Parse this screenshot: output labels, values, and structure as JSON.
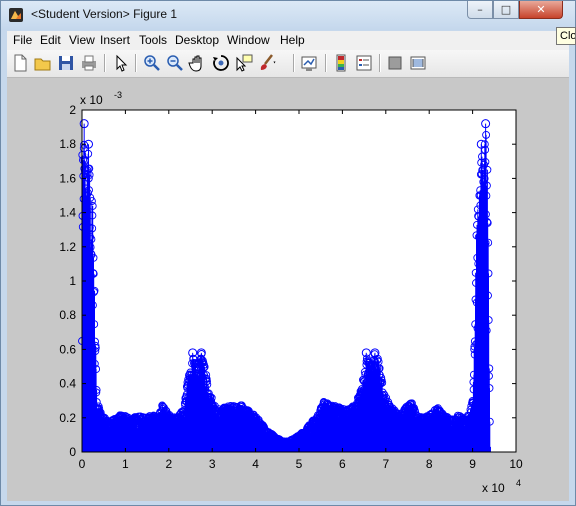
{
  "window": {
    "title": "<Student Version> Figure 1",
    "minimize_glyph": "–",
    "maximize_glyph": "□",
    "close_glyph": "✕",
    "tooltip": "Close"
  },
  "menu": [
    "File",
    "Edit",
    "View",
    "Insert",
    "Tools",
    "Desktop",
    "Window",
    "Help"
  ],
  "toolbar": {
    "icons": [
      "new-figure-icon",
      "open-file-icon",
      "save-icon",
      "print-icon",
      "edit-plot-arrow-icon",
      "zoom-in-icon",
      "zoom-out-icon",
      "pan-hand-icon",
      "rotate-3d-icon",
      "data-cursor-icon",
      "brush-icon",
      "link-plot-icon",
      "colorbar-icon",
      "legend-icon",
      "hide-plot-tools-icon",
      "show-plot-tools-icon"
    ]
  },
  "colors": {
    "series": "#0000ff",
    "axes_bg": "#ffffff",
    "figure_bg": "#c8c8c8"
  },
  "chart_data": {
    "type": "stem",
    "title": "",
    "xlabel": "",
    "ylabel": "",
    "x_exponent_label": "x 10^4",
    "y_exponent_label": "x 10^-3",
    "xlim": [
      0,
      10
    ],
    "ylim": [
      0,
      2
    ],
    "xticks": [
      0,
      1,
      2,
      3,
      4,
      5,
      6,
      7,
      8,
      9,
      10
    ],
    "yticks": [
      "0",
      "0.2",
      "0.4",
      "0.6",
      "0.8",
      "1",
      "1.2",
      "1.4",
      "1.6",
      "1.8",
      "2"
    ],
    "ytick_values": [
      0,
      0.2,
      0.4,
      0.6,
      0.8,
      1.0,
      1.2,
      1.4,
      1.6,
      1.8,
      2.0
    ],
    "grid": false,
    "marker": "circle",
    "envelope": [
      [
        0.0,
        1.75
      ],
      [
        0.05,
        1.92
      ],
      [
        0.1,
        1.6
      ],
      [
        0.15,
        1.8
      ],
      [
        0.2,
        1.5
      ],
      [
        0.25,
        1.48
      ],
      [
        0.3,
        0.8
      ],
      [
        0.35,
        0.3
      ],
      [
        0.45,
        0.22
      ],
      [
        0.6,
        0.18
      ],
      [
        0.8,
        0.2
      ],
      [
        0.9,
        0.22
      ],
      [
        1.1,
        0.2
      ],
      [
        1.3,
        0.21
      ],
      [
        1.5,
        0.2
      ],
      [
        1.6,
        0.22
      ],
      [
        1.75,
        0.2
      ],
      [
        1.85,
        0.28
      ],
      [
        2.0,
        0.22
      ],
      [
        2.2,
        0.2
      ],
      [
        2.3,
        0.24
      ],
      [
        2.4,
        0.35
      ],
      [
        2.5,
        0.55
      ],
      [
        2.55,
        0.58
      ],
      [
        2.65,
        0.48
      ],
      [
        2.75,
        0.58
      ],
      [
        2.85,
        0.5
      ],
      [
        2.9,
        0.38
      ],
      [
        3.05,
        0.28
      ],
      [
        3.2,
        0.25
      ],
      [
        3.35,
        0.27
      ],
      [
        3.5,
        0.27
      ],
      [
        3.65,
        0.28
      ],
      [
        3.8,
        0.25
      ],
      [
        3.95,
        0.22
      ],
      [
        4.1,
        0.18
      ],
      [
        4.3,
        0.12
      ],
      [
        4.5,
        0.08
      ],
      [
        4.7,
        0.06
      ],
      [
        4.9,
        0.08
      ],
      [
        5.1,
        0.12
      ],
      [
        5.3,
        0.18
      ],
      [
        5.45,
        0.22
      ],
      [
        5.55,
        0.3
      ],
      [
        5.7,
        0.28
      ],
      [
        5.85,
        0.27
      ],
      [
        6.0,
        0.26
      ],
      [
        6.15,
        0.25
      ],
      [
        6.3,
        0.28
      ],
      [
        6.45,
        0.38
      ],
      [
        6.55,
        0.58
      ],
      [
        6.65,
        0.5
      ],
      [
        6.75,
        0.58
      ],
      [
        6.85,
        0.55
      ],
      [
        6.95,
        0.35
      ],
      [
        7.1,
        0.27
      ],
      [
        7.3,
        0.22
      ],
      [
        7.45,
        0.26
      ],
      [
        7.6,
        0.3
      ],
      [
        7.7,
        0.22
      ],
      [
        7.85,
        0.2
      ],
      [
        8.0,
        0.22
      ],
      [
        8.2,
        0.26
      ],
      [
        8.35,
        0.21
      ],
      [
        8.5,
        0.2
      ],
      [
        8.7,
        0.22
      ],
      [
        8.85,
        0.19
      ],
      [
        9.0,
        0.3
      ],
      [
        9.05,
        0.8
      ],
      [
        9.1,
        1.48
      ],
      [
        9.15,
        1.5
      ],
      [
        9.2,
        1.8
      ],
      [
        9.25,
        1.6
      ],
      [
        9.3,
        1.92
      ],
      [
        9.35,
        1.75
      ],
      [
        9.4,
        0.05
      ]
    ],
    "peaks": [
      {
        "x": 0.05,
        "y": 1.92
      },
      {
        "x": 0.15,
        "y": 1.8
      },
      {
        "x": 2.55,
        "y": 0.58
      },
      {
        "x": 2.75,
        "y": 0.58
      },
      {
        "x": 6.55,
        "y": 0.58
      },
      {
        "x": 6.75,
        "y": 0.58
      },
      {
        "x": 9.2,
        "y": 1.8
      },
      {
        "x": 9.3,
        "y": 1.92
      }
    ]
  }
}
